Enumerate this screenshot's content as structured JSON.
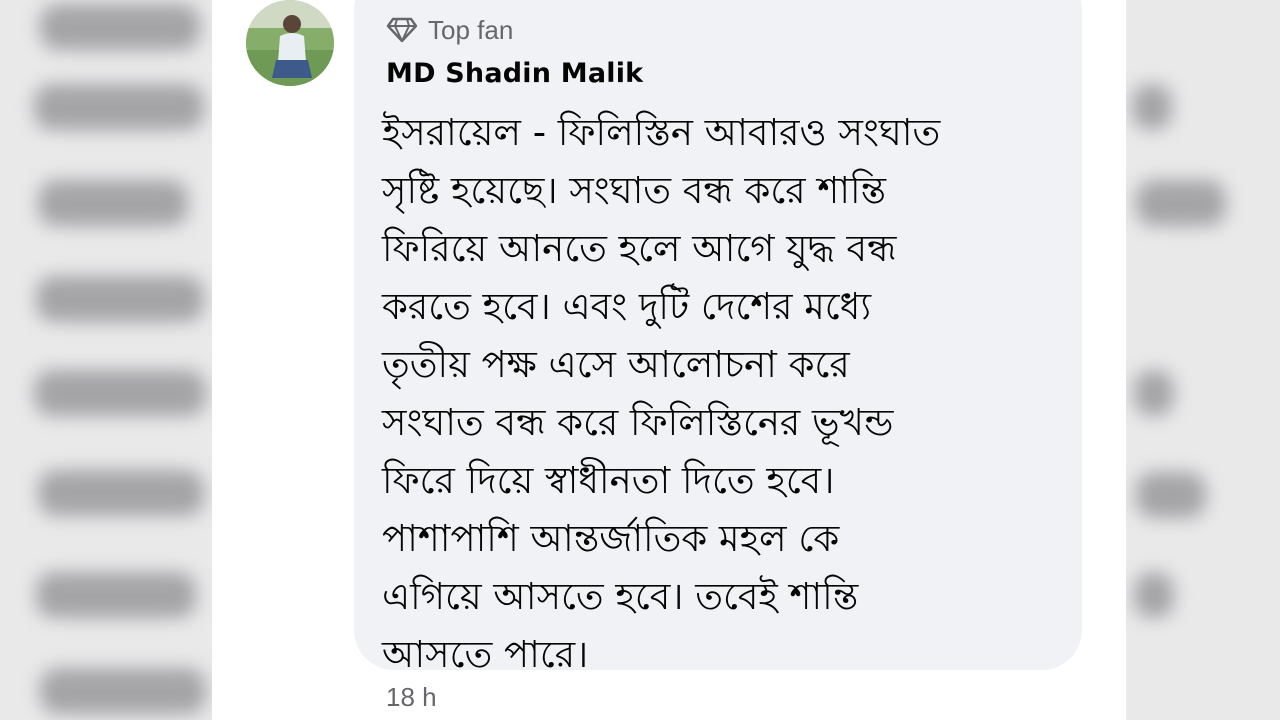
{
  "comment": {
    "badge_label": "Top fan",
    "badge_icon": "diamond-icon",
    "author_name": "MD Shadin Malik",
    "text_lines": [
      "ইসরায়েল - ফিলিস্তিন আবারও সংঘাত",
      "সৃষ্টি হয়েছে। সংঘাত বন্ধ করে শান্তি",
      "ফিরিয়ে আনতে হলে আগে যুদ্ধ বন্ধ",
      "করতে হবে। এবং দুটি দেশের মধ্যে",
      "তৃতীয় পক্ষ এসে আলোচনা করে",
      "সংঘাত বন্ধ করে ফিলিস্তিনের ভূখন্ড",
      "ফিরে দিয়ে স্বাধীনতা দিতে হবে।",
      "পাশাপাশি আন্তর্জাতিক মহল কে",
      "এগিয়ে আসতে হবে। তবেই শান্তি",
      "আসতে পারে।"
    ],
    "timestamp": "18 h"
  },
  "colors": {
    "bubble_bg": "#f0f2f5",
    "secondary_text": "#65676b",
    "primary_text": "#050505",
    "side_bg": "#e9e9ea"
  }
}
